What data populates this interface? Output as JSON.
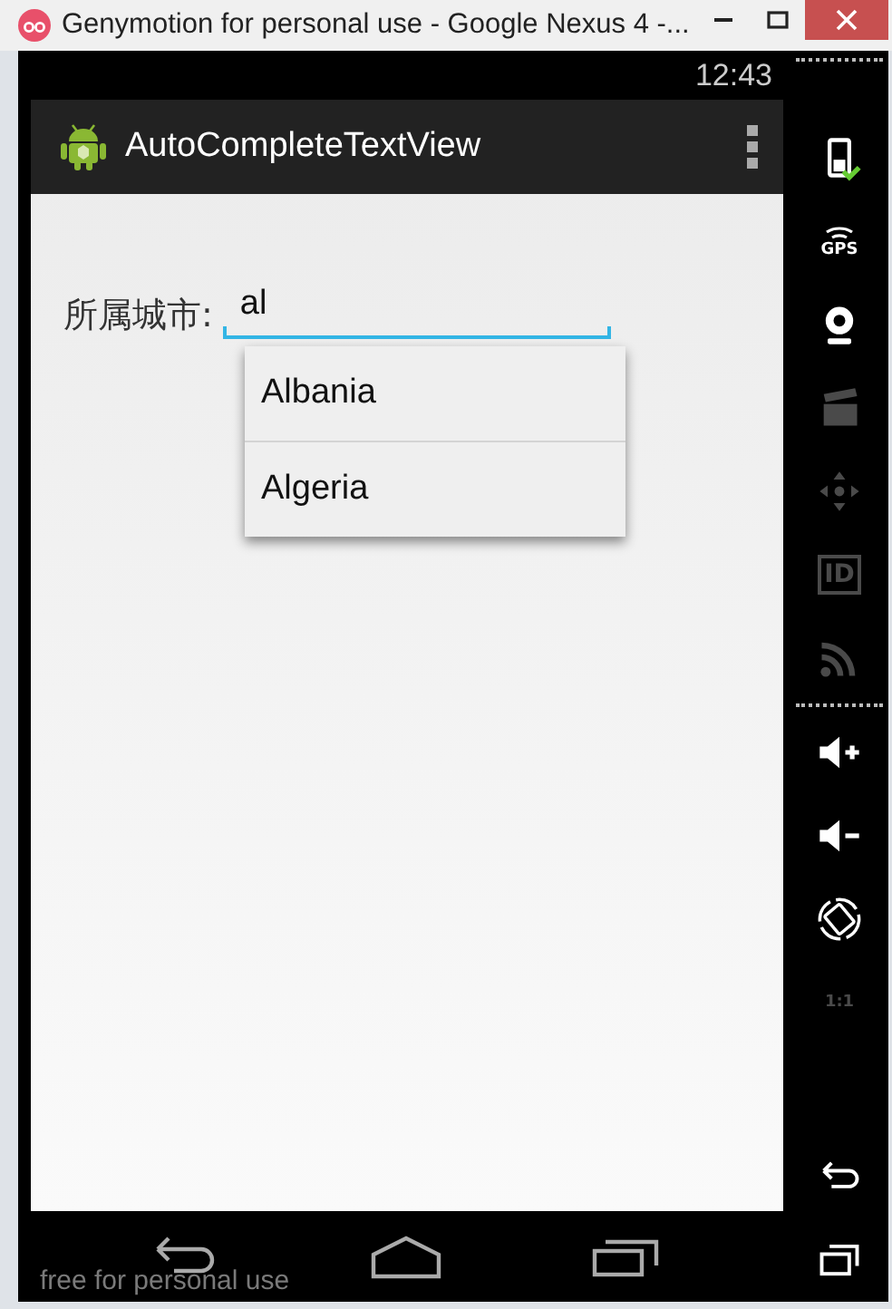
{
  "window": {
    "title": "Genymotion for personal use - Google Nexus 4 -..."
  },
  "status_bar": {
    "time": "12:43"
  },
  "action_bar": {
    "title": "AutoCompleteTextView"
  },
  "form": {
    "label": "所属城市:",
    "value": "al"
  },
  "suggestions": [
    {
      "text": "Albania"
    },
    {
      "text": "Algeria"
    }
  ],
  "sidebar": {
    "top": [
      {
        "kind": "battery",
        "disabled": false
      },
      {
        "kind": "gps",
        "label": "GPS",
        "disabled": false
      },
      {
        "kind": "webcam",
        "disabled": false
      },
      {
        "kind": "clapper",
        "disabled": true
      },
      {
        "kind": "dpad",
        "disabled": true
      },
      {
        "kind": "id",
        "label": "ID",
        "disabled": true
      },
      {
        "kind": "rss",
        "disabled": true
      }
    ],
    "middle": [
      {
        "kind": "volume-up",
        "disabled": false
      },
      {
        "kind": "volume-down",
        "disabled": false
      },
      {
        "kind": "rotate",
        "disabled": false
      },
      {
        "kind": "pixel",
        "label": "1:1",
        "disabled": true
      }
    ],
    "bottom": [
      {
        "kind": "back",
        "disabled": false
      },
      {
        "kind": "recent",
        "disabled": false
      }
    ]
  },
  "nav_bar": [
    {
      "kind": "back"
    },
    {
      "kind": "home"
    },
    {
      "kind": "recent"
    }
  ],
  "footer": {
    "text": "free for personal use"
  }
}
